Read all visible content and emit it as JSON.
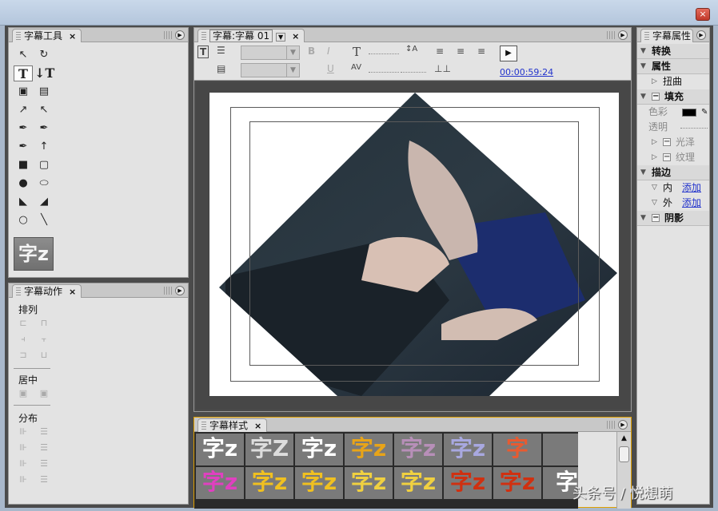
{
  "window": {
    "close_label": "×"
  },
  "tools_panel": {
    "title": "字幕工具",
    "close": "×",
    "tool_glyphs": [
      "↖",
      "↻",
      "T",
      "↓T",
      "▣",
      "▤",
      "↗",
      "↖",
      "✒",
      "✒",
      "✒",
      "↑",
      "■",
      "▢",
      "●",
      "⬭",
      "◣",
      "◢",
      "○",
      "╲"
    ],
    "sample_text": "字z"
  },
  "actions_panel": {
    "title": "字幕动作",
    "close": "×",
    "arrange_label": "排列",
    "center_label": "居中",
    "distribute_label": "分布"
  },
  "editor": {
    "tab_label": "字幕:字幕 01",
    "close": "×",
    "bold_label": "B",
    "italic_label": "I",
    "underline_label": "U",
    "timecode": "00:00:59:24"
  },
  "styles_panel": {
    "title": "字幕样式",
    "close": "×",
    "cells": [
      {
        "text": "字z",
        "color": "#ffffff"
      },
      {
        "text": "字Z",
        "color": "#dddddd"
      },
      {
        "text": "字z",
        "color": "#ffffff"
      },
      {
        "text": "字z",
        "color": "#e8a418"
      },
      {
        "text": "字z",
        "color": "#b78fb8"
      },
      {
        "text": "字z",
        "color": "#a8a8e0"
      },
      {
        "text": "字",
        "color": "#e85a30"
      },
      {
        "text": "",
        "color": "#e0a000"
      },
      {
        "text": "字z",
        "color": "#e040c0"
      },
      {
        "text": "字z",
        "color": "#f0c020"
      },
      {
        "text": "字z",
        "color": "#f0c020"
      },
      {
        "text": "字z",
        "color": "#f0d040"
      },
      {
        "text": "字z",
        "color": "#f0d040"
      },
      {
        "text": "字z",
        "color": "#d03010"
      },
      {
        "text": "字z",
        "color": "#d03010"
      },
      {
        "text": "字",
        "color": "#ffffff"
      }
    ]
  },
  "properties_panel": {
    "title": "字幕属性",
    "transform": "转换",
    "properties": "属性",
    "distort": "扭曲",
    "fill": "填充",
    "color_label": "色彩",
    "opacity_label": "透明",
    "sheen": "光泽",
    "texture": "纹理",
    "stroke": "描边",
    "inner_label": "内",
    "outer_label": "外",
    "add_inner": "添加",
    "add_outer": "添加",
    "shadow": "阴影",
    "fill_color": "#000000"
  },
  "watermark": "头条号 / 悦想萌"
}
